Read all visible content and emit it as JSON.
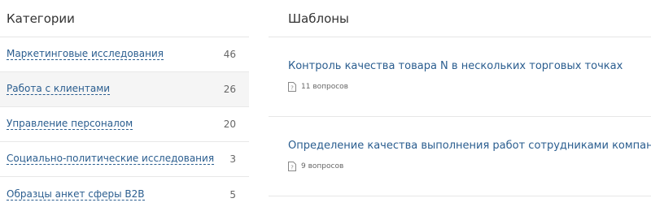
{
  "categories": {
    "title": "Категории",
    "items": [
      {
        "label": "Маркетинговые исследования",
        "count": "46"
      },
      {
        "label": "Работа с клиентами",
        "count": "26"
      },
      {
        "label": "Управление персоналом",
        "count": "20"
      },
      {
        "label": "Социально-политические исследования",
        "count": "3"
      },
      {
        "label": "Образцы анкет сферы B2B",
        "count": "5"
      }
    ]
  },
  "templates": {
    "title": "Шаблоны",
    "items": [
      {
        "title": "Контроль качества товара N в нескольких торговых точках",
        "questions": "11 вопросов",
        "icon": "document-icon"
      },
      {
        "title": "Определение качества выполнения работ сотрудниками компании",
        "questions": "9 вопросов",
        "icon": "document-icon"
      }
    ]
  },
  "colors": {
    "link": "#2a5d8f",
    "active_row_bg": "#f5f5f5",
    "divider": "#e6e6e6"
  }
}
